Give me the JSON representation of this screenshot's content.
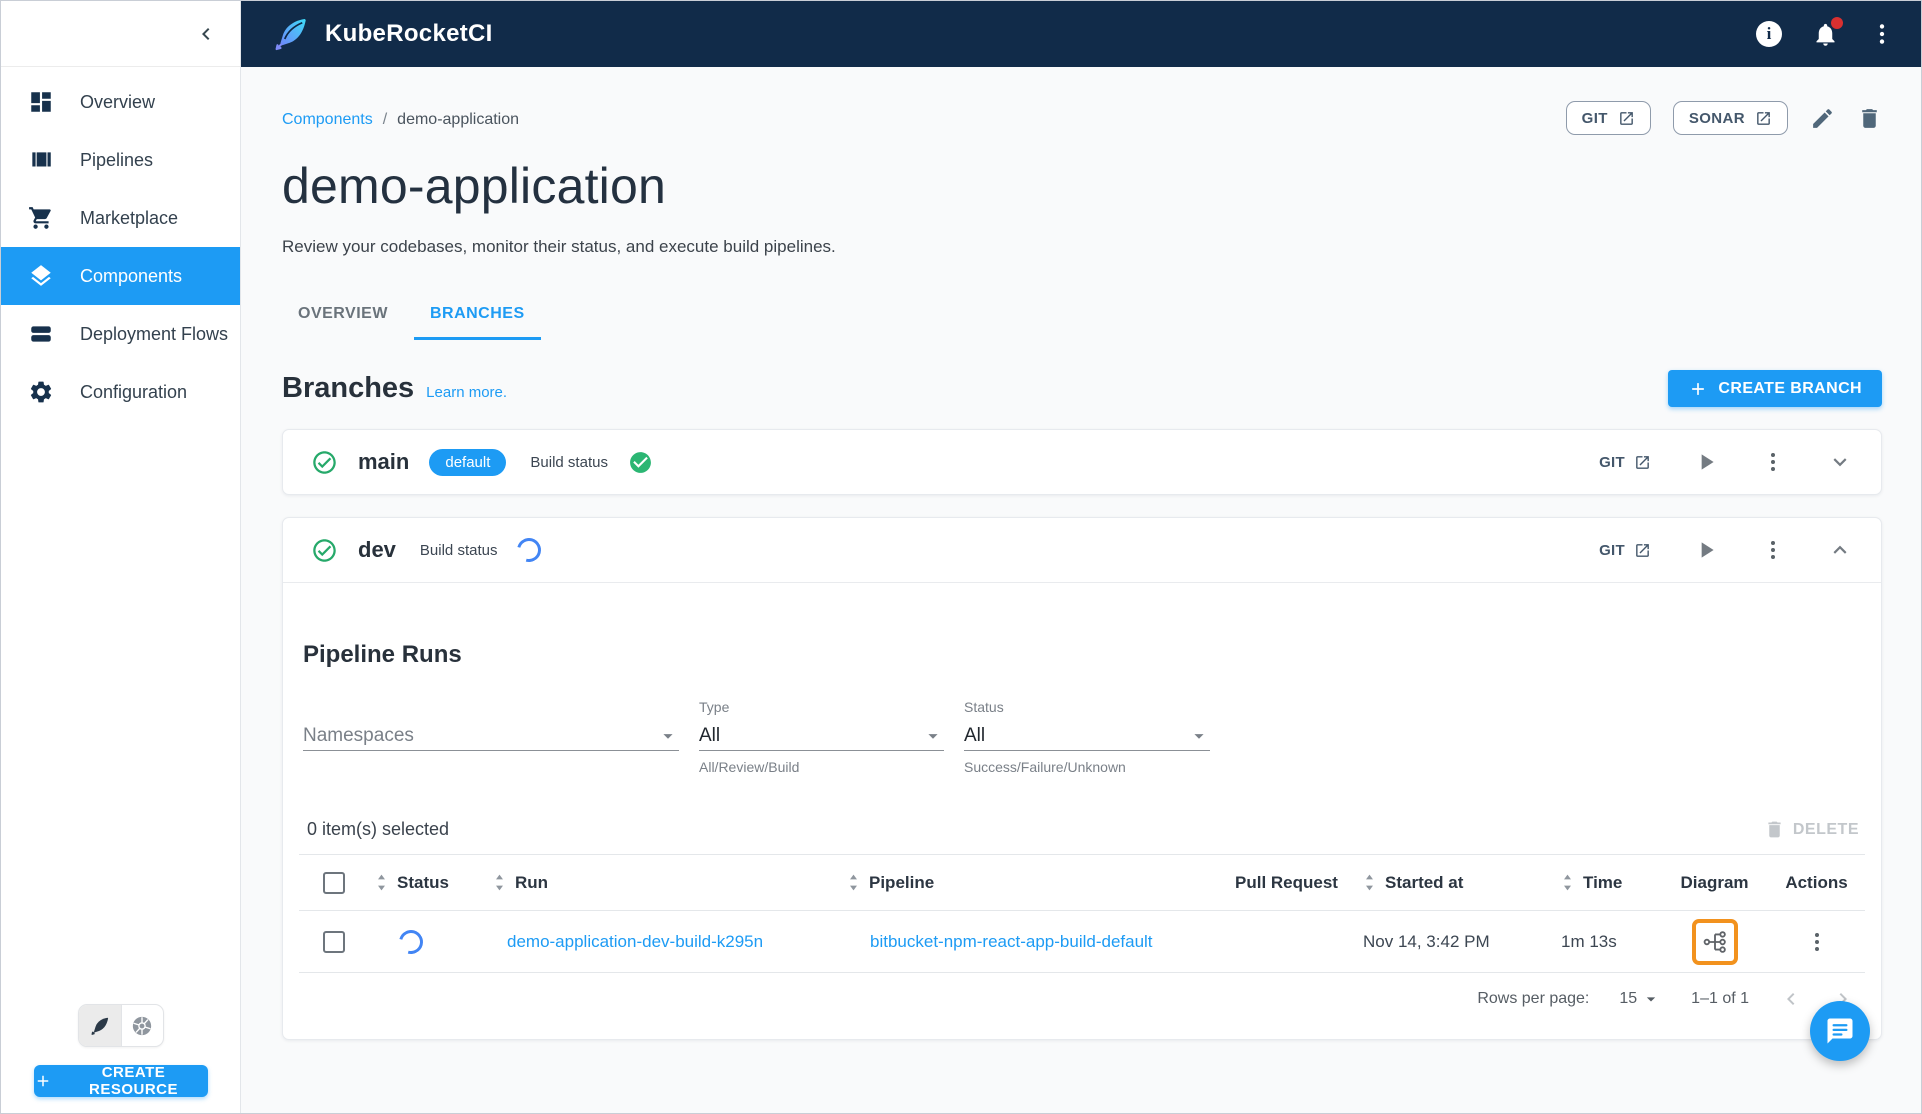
{
  "colors": {
    "accent_blue": "#1d9bf4",
    "header_navy": "#112b49",
    "success_green": "#2bb673",
    "running_blue": "#4285f4",
    "highlight_orange": "#f2921e",
    "slate_icon": "#50677a"
  },
  "icons": {
    "info_glyph": "i"
  },
  "topbar": {
    "app_title": "KubeRocketCI"
  },
  "sidebar": {
    "items": [
      {
        "label": "Overview"
      },
      {
        "label": "Pipelines"
      },
      {
        "label": "Marketplace"
      },
      {
        "label": "Components"
      },
      {
        "label": "Deployment Flows"
      },
      {
        "label": "Configuration"
      }
    ],
    "selected": "Components",
    "create_resource_label": "CREATE RESOURCE"
  },
  "breadcrumb": {
    "parent": "Components",
    "separator": "/",
    "current": "demo-application"
  },
  "page": {
    "title": "demo-application",
    "subtitle": "Review your codebases, monitor their status, and execute build pipelines.",
    "git_button": "GIT",
    "sonar_button": "SONAR"
  },
  "tabs": {
    "overview": "OVERVIEW",
    "branches": "BRANCHES"
  },
  "branches": {
    "heading": "Branches",
    "learn_more": "Learn more.",
    "create_branch": "CREATE BRANCH",
    "main": {
      "name": "main",
      "badge": "default",
      "build_status_label": "Build status",
      "build_status": "success",
      "git_label": "GIT"
    },
    "dev": {
      "name": "dev",
      "build_status_label": "Build status",
      "build_status": "running",
      "git_label": "GIT"
    }
  },
  "pipeline_runs": {
    "heading": "Pipeline Runs",
    "filters": {
      "namespaces_placeholder": "Namespaces",
      "type_label": "Type",
      "type_value": "All",
      "type_helper": "All/Review/Build",
      "status_label": "Status",
      "status_value": "All",
      "status_helper": "Success/Failure/Unknown"
    },
    "selection_text": "0 item(s) selected",
    "delete_label": "DELETE",
    "columns": {
      "status": "Status",
      "run": "Run",
      "pipeline": "Pipeline",
      "pull_request": "Pull Request",
      "started_at": "Started at",
      "time": "Time",
      "diagram": "Diagram",
      "actions": "Actions"
    },
    "row": {
      "status": "running",
      "run": "demo-application-dev-build-k295n",
      "pipeline": "bitbucket-npm-react-app-build-default",
      "pull_request": "",
      "started_at": "Nov 14, 3:42 PM",
      "time": "1m 13s"
    },
    "pagination": {
      "rows_per_page_label": "Rows per page:",
      "rows_per_page_value": "15",
      "range": "1–1 of 1"
    }
  }
}
